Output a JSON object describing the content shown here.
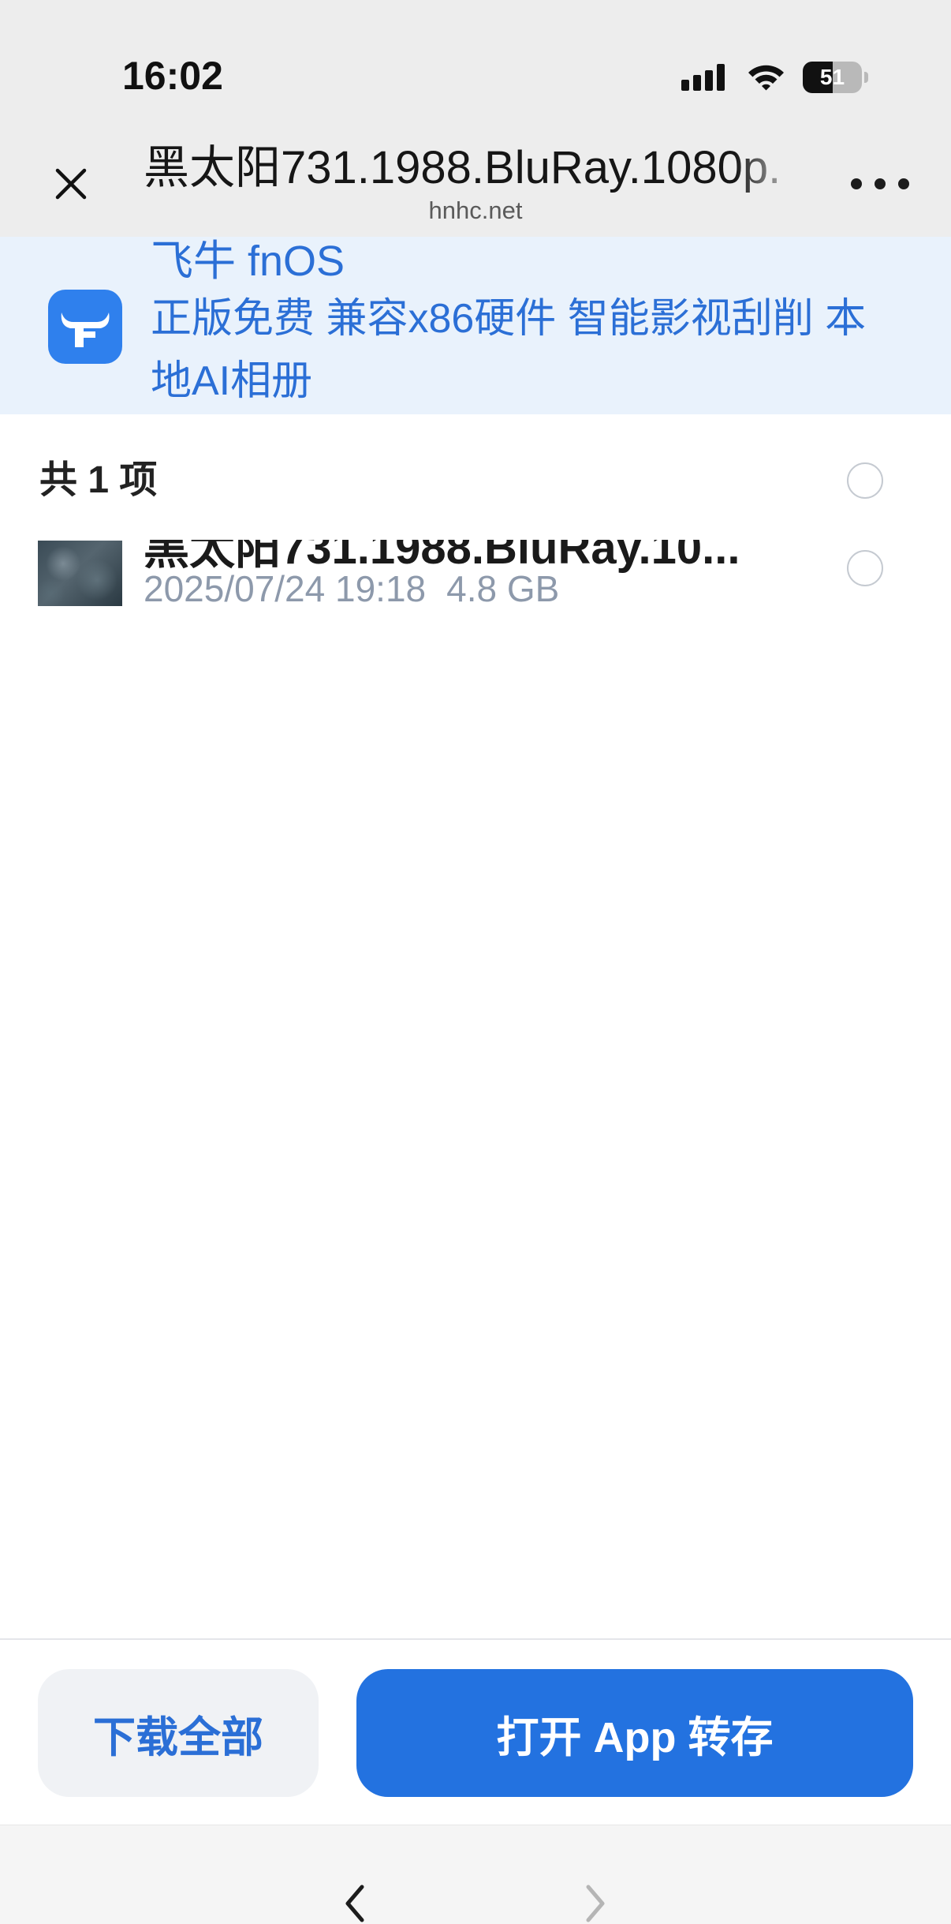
{
  "status_bar": {
    "time": "16:02",
    "battery_level": 51,
    "icons": {
      "signal": "cellular-signal-icon",
      "wifi": "wifi-icon",
      "battery": "battery-icon"
    }
  },
  "header": {
    "title": "黑太阳731.1988.BluRay.1080p.",
    "domain": "hnhc.net",
    "icons": {
      "close": "close-icon",
      "more": "more-options-icon"
    }
  },
  "banner": {
    "app_name": "飞牛 fnOS",
    "description": "正版免费 兼容x86硬件 智能影视刮削 本地AI相册",
    "icon": "fnos-logo-icon"
  },
  "file_list": {
    "count_label": "共 1 项",
    "all_selected": false,
    "items": [
      {
        "name": "黑太阳731.1988.BluRay.10...",
        "date": "2025/07/24 19:18",
        "size": "4.8 GB",
        "selected": false
      }
    ]
  },
  "actions": {
    "download_all_label": "下载全部",
    "open_app_save_label": "打开 App 转存"
  },
  "bottom_bar": {
    "icons": {
      "back": "chevron-left-icon",
      "forward": "chevron-right-icon"
    },
    "forward_enabled": false
  },
  "colors": {
    "accent": "#2372e0",
    "accent_text": "#2b6fd6",
    "banner_bg": "#e9f2fc",
    "chrome_bg": "#ededed",
    "meta_text": "#8d99ab",
    "bottom_bg": "#f5f5f5"
  }
}
